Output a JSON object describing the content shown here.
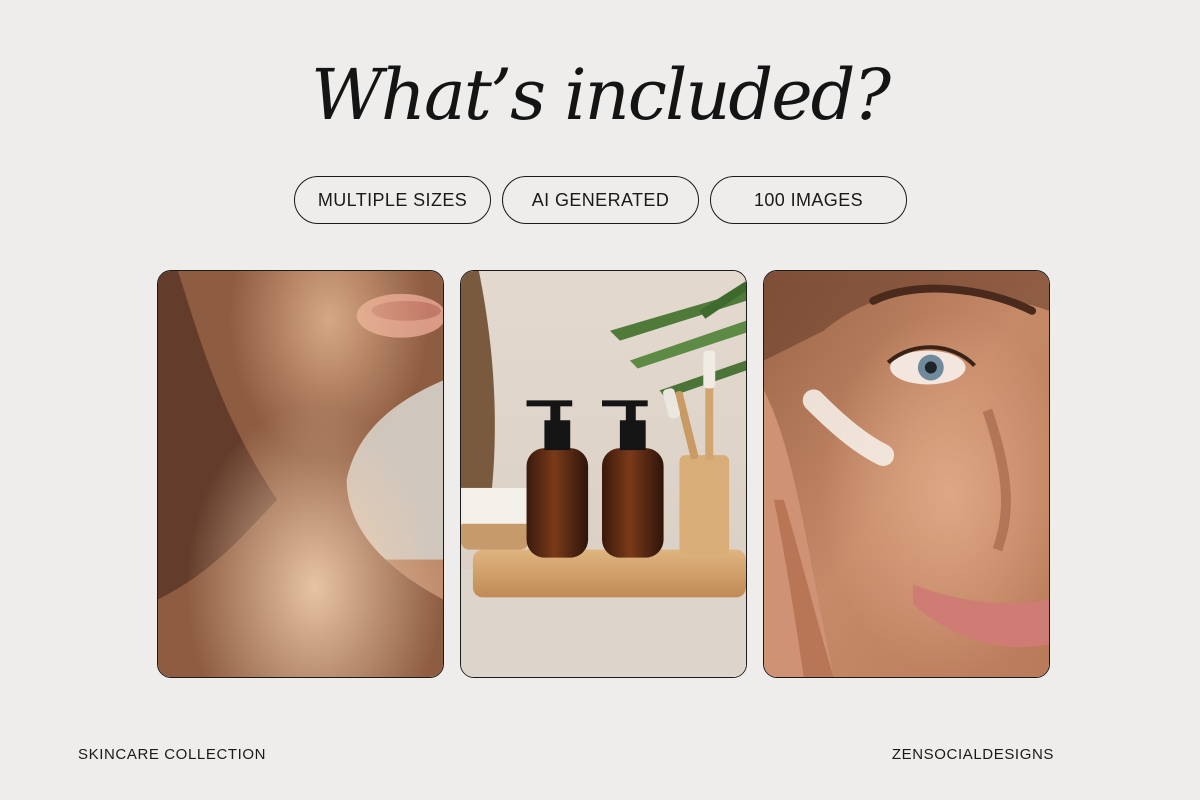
{
  "header": {
    "title": "What’s included?"
  },
  "features": [
    {
      "label": "MULTIPLE SIZES"
    },
    {
      "label": "AI GENERATED"
    },
    {
      "label": "100 IMAGES"
    }
  ],
  "photos": [
    {
      "subject": "neck-and-collarbone-skin"
    },
    {
      "subject": "amber-pump-bottles-bamboo-toothbrushes"
    },
    {
      "subject": "face-with-cream-swatch"
    }
  ],
  "footer": {
    "collection": "SKINCARE COLLECTION",
    "brand": "ZENSOCIALDESIGNS"
  },
  "colors": {
    "background": "#efedeb",
    "text": "#141414",
    "border": "#1a1a1a"
  }
}
